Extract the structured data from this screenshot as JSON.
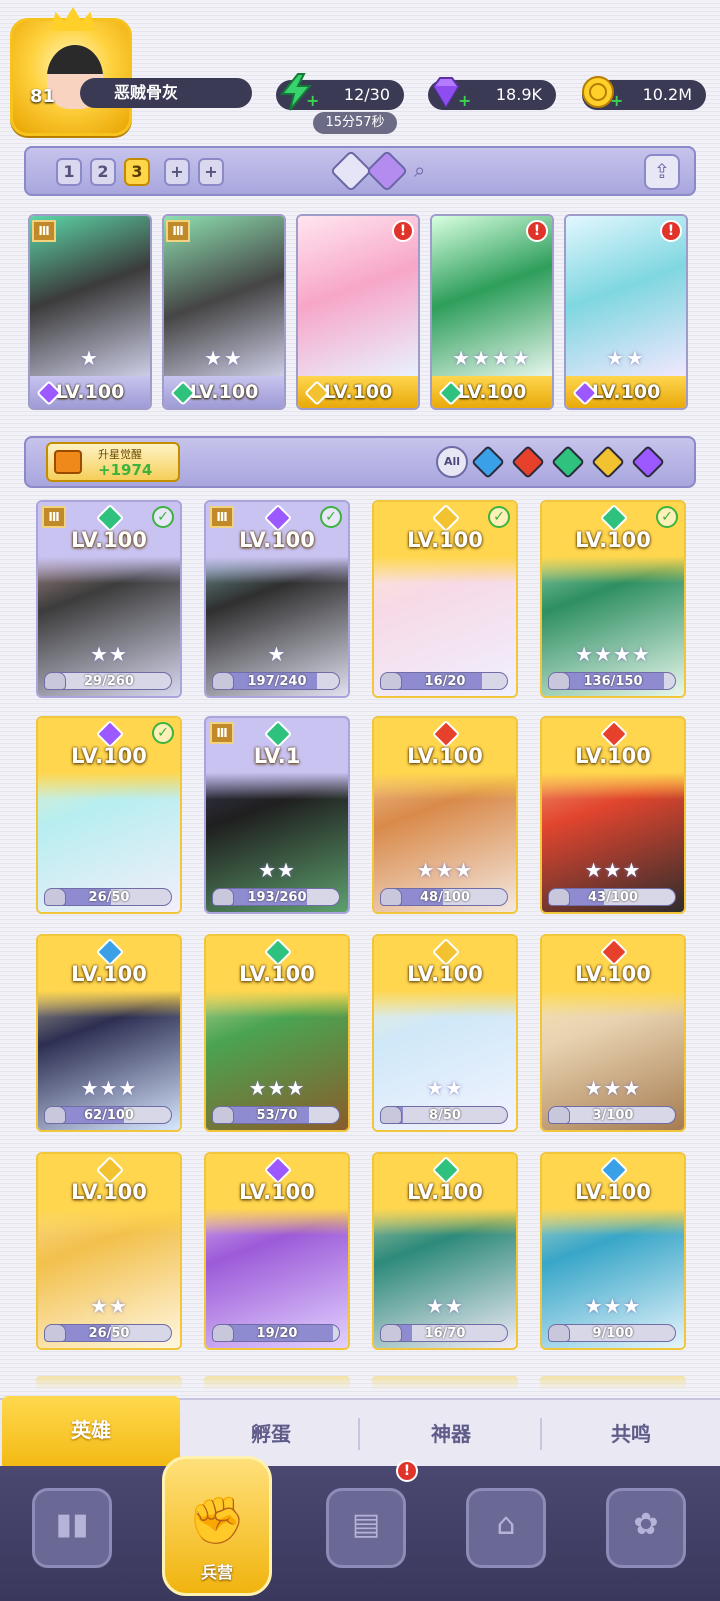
{
  "player": {
    "level": "81",
    "name": "恶贼骨灰"
  },
  "resources": {
    "energy": "12/30",
    "energy_timer": "15分57秒",
    "gems": "18.9K",
    "coins": "10.2M"
  },
  "squad": {
    "tabs": [
      "1",
      "2",
      "3",
      "+",
      "+"
    ],
    "active_tab": "3"
  },
  "team": [
    {
      "level": "LV.100",
      "stars": "★",
      "element_color": "#9b59ff",
      "frame": "purple"
    },
    {
      "level": "LV.100",
      "stars": "★★",
      "element_color": "#2ec27e",
      "frame": "purple"
    },
    {
      "level": "LV.100",
      "stars": "",
      "element_color": "#f2c230",
      "frame": "gold"
    },
    {
      "level": "LV.100",
      "stars": "★★★★",
      "element_color": "#2ec27e",
      "frame": "gold"
    },
    {
      "level": "LV.100",
      "stars": "★★",
      "element_color": "#9b59ff",
      "frame": "gold"
    }
  ],
  "awaken": {
    "label": "升星觉醒",
    "value": "+1974"
  },
  "filter": {
    "all_label": "All",
    "elements": [
      "#3aa0e8",
      "#e8412b",
      "#2ec27e",
      "#f2c230",
      "#9b59ff"
    ]
  },
  "heroes": [
    {
      "level": "LV.100",
      "stars": "★★",
      "shards": "29/260",
      "progress": 0.11,
      "element_color": "#2ec27e",
      "frame": "purple",
      "checked": true
    },
    {
      "level": "LV.100",
      "stars": "★",
      "shards": "197/240",
      "progress": 0.82,
      "element_color": "#9b59ff",
      "frame": "purple",
      "checked": true
    },
    {
      "level": "LV.100",
      "stars": "",
      "shards": "16/20",
      "progress": 0.8,
      "element_color": "#f2c230",
      "frame": "gold",
      "checked": true
    },
    {
      "level": "LV.100",
      "stars": "★★★★",
      "shards": "136/150",
      "progress": 0.91,
      "element_color": "#2ec27e",
      "frame": "gold",
      "checked": true
    },
    {
      "level": "LV.100",
      "stars": "",
      "shards": "26/50",
      "progress": 0.52,
      "element_color": "#9b59ff",
      "frame": "gold",
      "checked": true
    },
    {
      "level": "LV.1",
      "stars": "★★",
      "shards": "193/260",
      "progress": 0.74,
      "element_color": "#2ec27e",
      "frame": "purple",
      "checked": false
    },
    {
      "level": "LV.100",
      "stars": "★★★",
      "shards": "48/100",
      "progress": 0.48,
      "element_color": "#e8412b",
      "frame": "gold",
      "checked": false
    },
    {
      "level": "LV.100",
      "stars": "★★★",
      "shards": "43/100",
      "progress": 0.43,
      "element_color": "#e8412b",
      "frame": "gold",
      "checked": false
    },
    {
      "level": "LV.100",
      "stars": "★★★",
      "shards": "62/100",
      "progress": 0.62,
      "element_color": "#3aa0e8",
      "frame": "gold",
      "checked": false
    },
    {
      "level": "LV.100",
      "stars": "★★★",
      "shards": "53/70",
      "progress": 0.76,
      "element_color": "#2ec27e",
      "frame": "gold",
      "checked": false
    },
    {
      "level": "LV.100",
      "stars": "★★",
      "shards": "8/50",
      "progress": 0.16,
      "element_color": "#f2c230",
      "frame": "gold",
      "checked": false
    },
    {
      "level": "LV.100",
      "stars": "★★★",
      "shards": "3/100",
      "progress": 0.03,
      "element_color": "#e8412b",
      "frame": "gold",
      "checked": false
    },
    {
      "level": "LV.100",
      "stars": "★★",
      "shards": "26/50",
      "progress": 0.52,
      "element_color": "#f2c230",
      "frame": "gold",
      "checked": false
    },
    {
      "level": "LV.100",
      "stars": "",
      "shards": "19/20",
      "progress": 0.95,
      "element_color": "#9b59ff",
      "frame": "gold",
      "checked": false
    },
    {
      "level": "LV.100",
      "stars": "★★",
      "shards": "16/70",
      "progress": 0.23,
      "element_color": "#2ec27e",
      "frame": "gold",
      "checked": false
    },
    {
      "level": "LV.100",
      "stars": "★★★",
      "shards": "9/100",
      "progress": 0.09,
      "element_color": "#3aa0e8",
      "frame": "gold",
      "checked": false
    }
  ],
  "subtabs": [
    "英雄",
    "孵蛋",
    "神器",
    "共鸣"
  ],
  "nav": {
    "active_label": "兵营"
  }
}
